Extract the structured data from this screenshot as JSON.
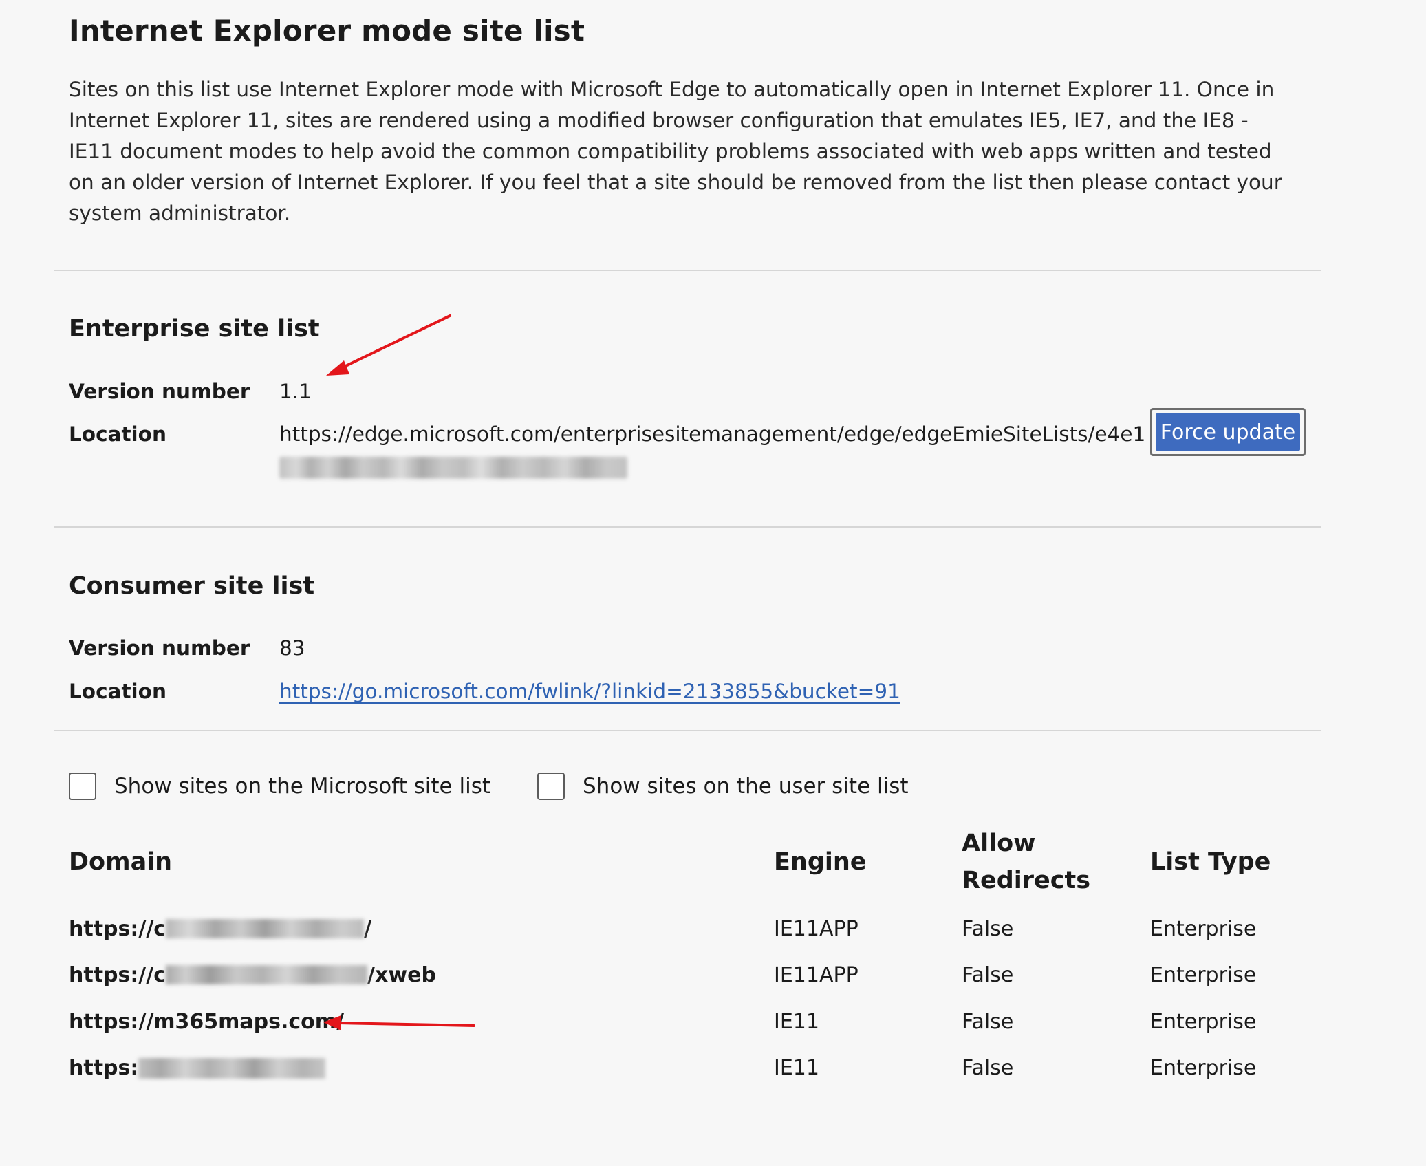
{
  "page": {
    "title": "Internet Explorer mode site list",
    "description": "Sites on this list use Internet Explorer mode with Microsoft Edge to automatically open in Internet Explorer 11. Once in Internet Explorer 11, sites are rendered using a modified browser configuration that emulates IE5, IE7, and the IE8 - IE11 document modes to help avoid the common compatibility problems associated with web apps written and tested on an older version of Internet Explorer. If you feel that a site should be removed from the list then please contact your system administrator."
  },
  "enterprise": {
    "heading": "Enterprise site list",
    "version_label": "Version number",
    "version_value": "1.1",
    "location_label": "Location",
    "location_value": "https://edge.microsoft.com/enterprisesitemanagement/edge/edgeEmieSiteLists/e4e1",
    "force_update_label": "Force update"
  },
  "consumer": {
    "heading": "Consumer site list",
    "version_label": "Version number",
    "version_value": "83",
    "location_label": "Location",
    "location_value": "https://go.microsoft.com/fwlink/?linkid=2133855&bucket=91"
  },
  "filters": {
    "microsoft_list_label": "Show sites on the Microsoft site list",
    "microsoft_list_checked": false,
    "user_list_label": "Show sites on the user site list",
    "user_list_checked": false
  },
  "table": {
    "headers": {
      "domain": "Domain",
      "engine": "Engine",
      "allow_redirects_line1": "Allow",
      "allow_redirects_line2": "Redirects",
      "list_type": "List Type"
    },
    "rows": [
      {
        "domain_prefix": "https://c",
        "domain_suffix": "/",
        "engine": "IE11APP",
        "allow_redirects": "False",
        "list_type": "Enterprise"
      },
      {
        "domain_prefix": "https://c",
        "domain_suffix": "/xweb",
        "engine": "IE11APP",
        "allow_redirects": "False",
        "list_type": "Enterprise"
      },
      {
        "domain_prefix": "https://m365maps.com/",
        "domain_suffix": "",
        "engine": "IE11",
        "allow_redirects": "False",
        "list_type": "Enterprise"
      },
      {
        "domain_prefix": "https:",
        "domain_suffix": "",
        "engine": "IE11",
        "allow_redirects": "False",
        "list_type": "Enterprise"
      }
    ]
  },
  "colors": {
    "background": "#f7f7f7",
    "link": "#2f62b3",
    "button": "#3e6bbf",
    "annotation_arrow": "#e3161b"
  }
}
